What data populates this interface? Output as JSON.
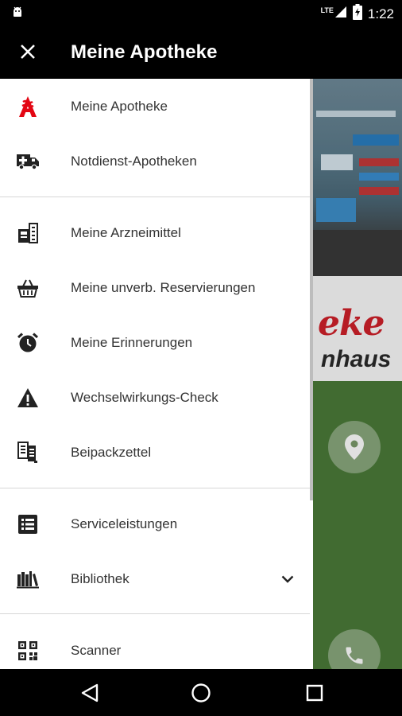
{
  "status_bar": {
    "network": "LTE",
    "battery_level": "⚡",
    "time": "1:22"
  },
  "app_bar": {
    "title": "Meine Apotheke",
    "close_icon": "close-icon"
  },
  "drawer": {
    "sections": [
      [
        {
          "label": "Meine Apotheke",
          "icon": "pharmacy-a-icon"
        },
        {
          "label": "Notdienst-Apotheken",
          "icon": "ambulance-icon"
        }
      ],
      [
        {
          "label": "Meine Arzneimittel",
          "icon": "medicine-box-icon"
        },
        {
          "label": "Meine unverb. Reservierungen",
          "icon": "basket-icon"
        },
        {
          "label": "Meine Erinnerungen",
          "icon": "alarm-clock-icon"
        },
        {
          "label": "Wechselwirkungs-Check",
          "icon": "warning-icon"
        },
        {
          "label": "Beipackzettel",
          "icon": "leaflet-icon"
        }
      ],
      [
        {
          "label": "Serviceleistungen",
          "icon": "service-list-icon"
        },
        {
          "label": "Bibliothek",
          "icon": "library-icon",
          "expandable": true
        }
      ],
      [
        {
          "label": "Scanner",
          "icon": "qr-code-icon"
        }
      ]
    ]
  },
  "background_page": {
    "logo_line1": "eke",
    "logo_line2": "nhaus",
    "fab_icons": [
      "location-pin-icon",
      "phone-icon"
    ]
  },
  "colors": {
    "accent": "#e30613",
    "bar": "#000000",
    "drawer_bg": "#ffffff",
    "bg_green": "#4a7a38"
  }
}
